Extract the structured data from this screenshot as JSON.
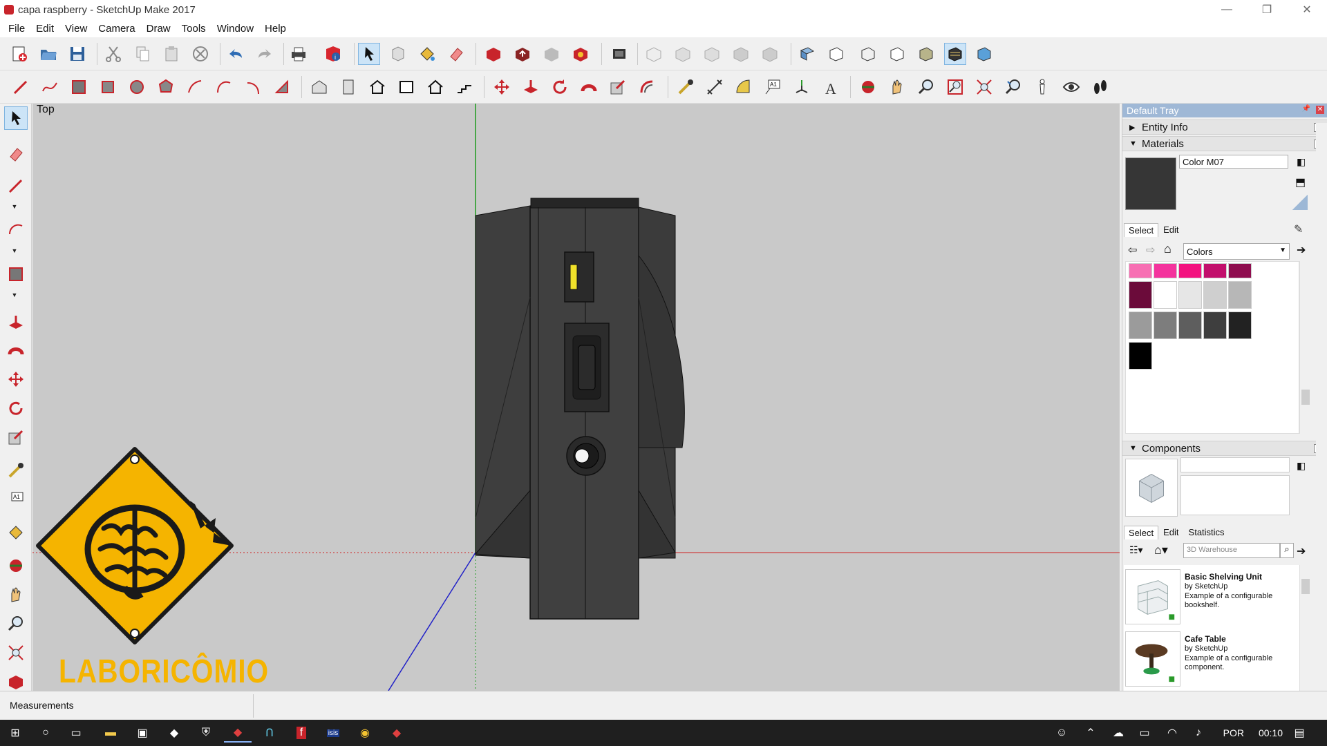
{
  "window": {
    "title": "capa raspberry - SketchUp Make 2017",
    "minimize": "—",
    "maximize": "❐",
    "close": "✕"
  },
  "menu": [
    "File",
    "Edit",
    "View",
    "Camera",
    "Draw",
    "Tools",
    "Window",
    "Help"
  ],
  "viewport": {
    "label": "Top",
    "background": "#c9c9c9"
  },
  "logo": {
    "text": "LABORICÔMIO",
    "color": "#f5b400"
  },
  "tray": {
    "title": "Default Tray",
    "entity_info": "Entity Info",
    "materials": {
      "heading": "Materials",
      "current_name": "Color M07",
      "current_color": "#363636",
      "tabs": [
        "Select",
        "Edit"
      ],
      "collection": "Colors",
      "swatches": [
        "#f76fb3",
        "#f4339d",
        "#f3127f",
        "#c20f6c",
        "#8f0d4f",
        "#6b0b3a",
        "#ffffff",
        "#e6e6e6",
        "#cfcfcf",
        "#b7b7b7",
        "#9b9b9b",
        "#7d7d7d",
        "#5e5e5e",
        "#3e3e3e",
        "#222222",
        "#000000"
      ]
    },
    "components": {
      "heading": "Components",
      "tabs": [
        "Select",
        "Edit",
        "Statistics"
      ],
      "search_placeholder": "3D Warehouse",
      "items": [
        {
          "title": "Basic Shelving Unit",
          "by": "by SketchUp",
          "desc": "Example of a configurable bookshelf."
        },
        {
          "title": "Cafe Table",
          "by": "by SketchUp",
          "desc": "Example of a configurable component."
        }
      ]
    }
  },
  "status": {
    "measurements": "Measurements"
  },
  "taskbar": {
    "lang": "POR",
    "time": "00:10"
  }
}
